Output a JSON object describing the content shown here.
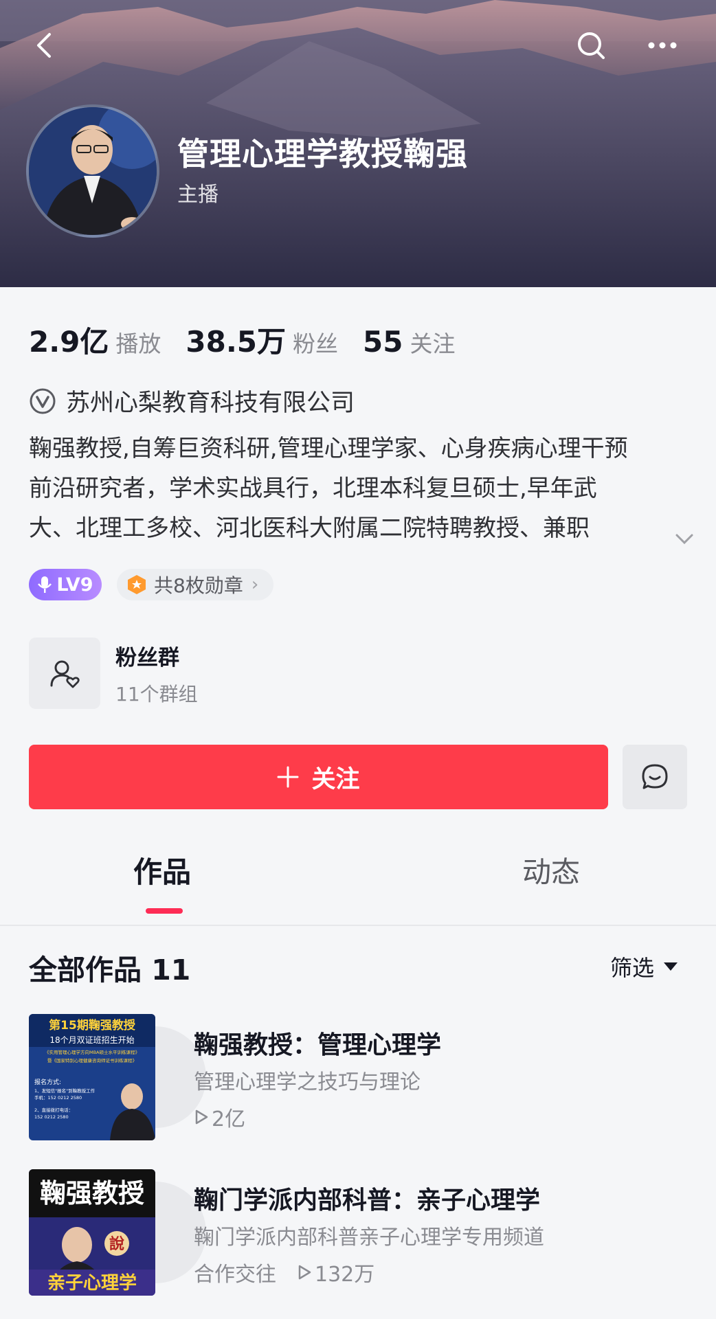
{
  "header": {
    "name": "管理心理学教授鞠强",
    "role": "主播"
  },
  "stats": [
    {
      "value": "2.9亿",
      "label": "播放"
    },
    {
      "value": "38.5万",
      "label": "粉丝"
    },
    {
      "value": "55",
      "label": "关注"
    }
  ],
  "company": "苏州心梨教育科技有限公司",
  "bio": {
    "line1": "鞠强教授,自筹巨资科研,管理心理学家、心身疾病心理干预",
    "line2": "前沿研究者，学术实战具行，北理本科复旦硕士,早年武",
    "line3": "大、北理工多校、河北医科大附属二院特聘教授、兼职"
  },
  "badges": {
    "level": "LV9",
    "medals": "共8枚勋章"
  },
  "fan_group": {
    "title": "粉丝群",
    "count": "11个群组"
  },
  "actions": {
    "follow_label": "关注"
  },
  "tabs": {
    "works": "作品",
    "dynamic": "动态"
  },
  "list": {
    "heading": "全部作品 11",
    "filter": "筛选",
    "items": [
      {
        "title": "鞠强教授：管理心理学",
        "subtitle": "管理心理学之技巧与理论",
        "tag": "",
        "plays": "2亿",
        "thumb_lines": [
          "第15期鞠强教授",
          "18个月双证班招生开始",
          "《实用管理心理学方向MBA硕士水平训练课程》",
          "暨《国家特别心理健康咨询师证书训练课程》",
          "报名方式:",
          "1、发短信\"报名\"到鞠教授工作",
          "手机：152 0212 2580",
          "2、直接拨打电话：",
          "152 0212 2580"
        ]
      },
      {
        "title": "鞠门学派内部科普：亲子心理学",
        "subtitle": "鞠门学派内部科普亲子心理学专用频道",
        "tag": "合作交往",
        "plays": "132万",
        "thumb_lines": [
          "鞠强教授",
          "說",
          "亲子心理学"
        ]
      }
    ]
  },
  "colors": {
    "accent_red": "#fe3c4a",
    "tab_indicator": "#fe2c55",
    "level_purple": "#8f6bff"
  },
  "icons": [
    "back-icon",
    "search-icon",
    "more-icon",
    "verified-icon",
    "chevron-down-icon",
    "mic-icon",
    "medal-icon",
    "chevron-right-icon",
    "fan-group-icon",
    "plus-icon",
    "message-icon",
    "dropdown-triangle-icon",
    "play-icon"
  ]
}
